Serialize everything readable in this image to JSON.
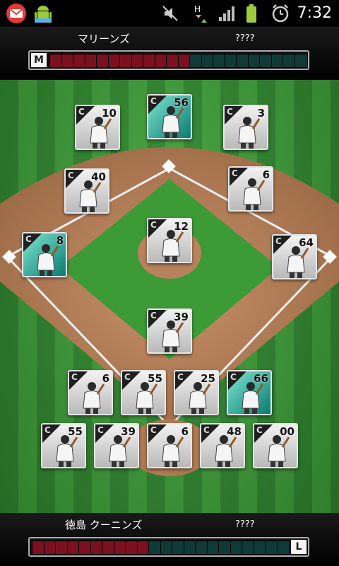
{
  "status_bar": {
    "time": "7:32",
    "icons": [
      "mail-icon",
      "android-icon",
      "mute-icon",
      "network-h-icon",
      "signal-icon",
      "battery-icon",
      "alarm-icon"
    ]
  },
  "top_team": {
    "name": "マリーンズ",
    "score": "????",
    "logo_letter": "M",
    "gauge_filled": 12,
    "gauge_total": 22
  },
  "bottom_team": {
    "name": "徳島 クーニンズ",
    "score": "????",
    "logo_letter": "L",
    "gauge_filled": 10,
    "gauge_total": 22
  },
  "colors": {
    "gauge_red": "#7a1020",
    "gauge_teal": "#0f3a38",
    "field_green": "#3fa23a",
    "dirt": "#b07a52"
  },
  "cards": [
    {
      "number": "10",
      "teal": false
    },
    {
      "number": "56",
      "teal": true
    },
    {
      "number": "3",
      "teal": false
    },
    {
      "number": "40",
      "teal": false
    },
    {
      "number": "6",
      "teal": false
    },
    {
      "number": "12",
      "teal": false
    },
    {
      "number": "8",
      "teal": true
    },
    {
      "number": "64",
      "teal": false
    },
    {
      "number": "39",
      "teal": false
    },
    {
      "number": "6",
      "teal": false
    },
    {
      "number": "55",
      "teal": false
    },
    {
      "number": "25",
      "teal": false
    },
    {
      "number": "66",
      "teal": true
    },
    {
      "number": "55",
      "teal": false
    },
    {
      "number": "39",
      "teal": false
    },
    {
      "number": "6",
      "teal": false
    },
    {
      "number": "48",
      "teal": false
    },
    {
      "number": "00",
      "teal": false
    }
  ]
}
